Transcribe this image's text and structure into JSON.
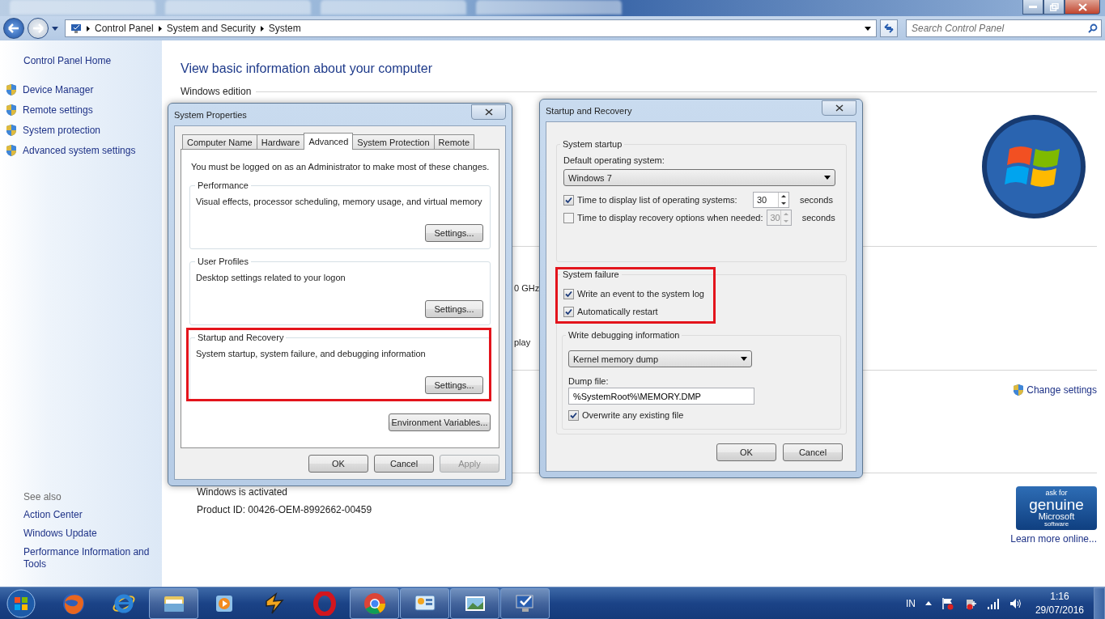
{
  "address_bar": {
    "breadcrumbs": [
      "Control Panel",
      "System and Security",
      "System"
    ],
    "search": {
      "placeholder": "Search Control Panel"
    }
  },
  "sidebar": {
    "home": "Control Panel Home",
    "tasks": [
      "Device Manager",
      "Remote settings",
      "System protection",
      "Advanced system settings"
    ],
    "see_also": "See also",
    "links": [
      "Action Center",
      "Windows Update",
      "Performance Information and Tools"
    ]
  },
  "content": {
    "heading": "View basic information about your computer",
    "section": "Windows edition",
    "fragments": [
      "0 GHz",
      "play"
    ],
    "change_settings": "Change settings",
    "activation": "Windows is activated",
    "product_id": "Product ID: 00426-OEM-8992662-00459",
    "genuine_logo": [
      "ask for",
      "genuine",
      "Microsoft",
      "software"
    ],
    "learn_more": "Learn more online..."
  },
  "system_properties": {
    "title": "System Properties",
    "tabs": [
      {
        "label": "Computer Name",
        "selected": false
      },
      {
        "label": "Hardware",
        "selected": false
      },
      {
        "label": "Advanced",
        "selected": true
      },
      {
        "label": "System Protection",
        "selected": false
      },
      {
        "label": "Remote",
        "selected": false
      }
    ],
    "notice": "You must be logged on as an Administrator to make most of these changes.",
    "groups": [
      {
        "title": "Performance",
        "description": "Visual effects, processor scheduling, memory usage, and virtual memory",
        "button": "Settings...",
        "highlighted": false
      },
      {
        "title": "User Profiles",
        "description": "Desktop settings related to your logon",
        "button": "Settings...",
        "highlighted": false
      },
      {
        "title": "Startup and Recovery",
        "description": "System startup, system failure, and debugging information",
        "button": "Settings...",
        "highlighted": true
      }
    ],
    "env_button": "Environment Variables...",
    "buttons": [
      {
        "label": "OK",
        "disabled": false
      },
      {
        "label": "Cancel",
        "disabled": false
      },
      {
        "label": "Apply",
        "disabled": true
      }
    ]
  },
  "startup_recovery": {
    "title": "Startup and Recovery",
    "system_startup": {
      "title": "System startup",
      "default_os_label": "Default operating system:",
      "default_os": "Windows 7",
      "options": [
        {
          "label": "Time to display list of operating systems:",
          "checked": true,
          "value": "30",
          "unit": "seconds"
        },
        {
          "label": "Time to display recovery options when needed:",
          "checked": false,
          "value": "30",
          "unit": "seconds"
        }
      ]
    },
    "system_failure": {
      "title": "System failure",
      "highlighted": true,
      "options": [
        {
          "label": "Write an event to the system log",
          "checked": true
        },
        {
          "label": "Automatically restart",
          "checked": true
        }
      ]
    },
    "debugging": {
      "title": "Write debugging information",
      "type": "Kernel memory dump",
      "dump_label": "Dump file:",
      "dump_file": "%SystemRoot%\\MEMORY.DMP",
      "overwrite": {
        "label": "Overwrite any existing file",
        "checked": true
      }
    },
    "buttons": [
      "OK",
      "Cancel"
    ]
  },
  "taskbar": {
    "apps": [
      {
        "kind": "firefox",
        "running": false
      },
      {
        "kind": "ie",
        "running": false
      },
      {
        "kind": "folder",
        "running": true
      },
      {
        "kind": "media",
        "running": false
      },
      {
        "kind": "winamp",
        "running": false
      },
      {
        "kind": "opera",
        "running": false
      },
      {
        "kind": "chrome",
        "running": true
      },
      {
        "kind": "panel",
        "running": true
      },
      {
        "kind": "photo",
        "running": true
      },
      {
        "kind": "system",
        "running": true
      }
    ],
    "language": "IN",
    "time": "1:16",
    "date": "29/07/2016"
  }
}
